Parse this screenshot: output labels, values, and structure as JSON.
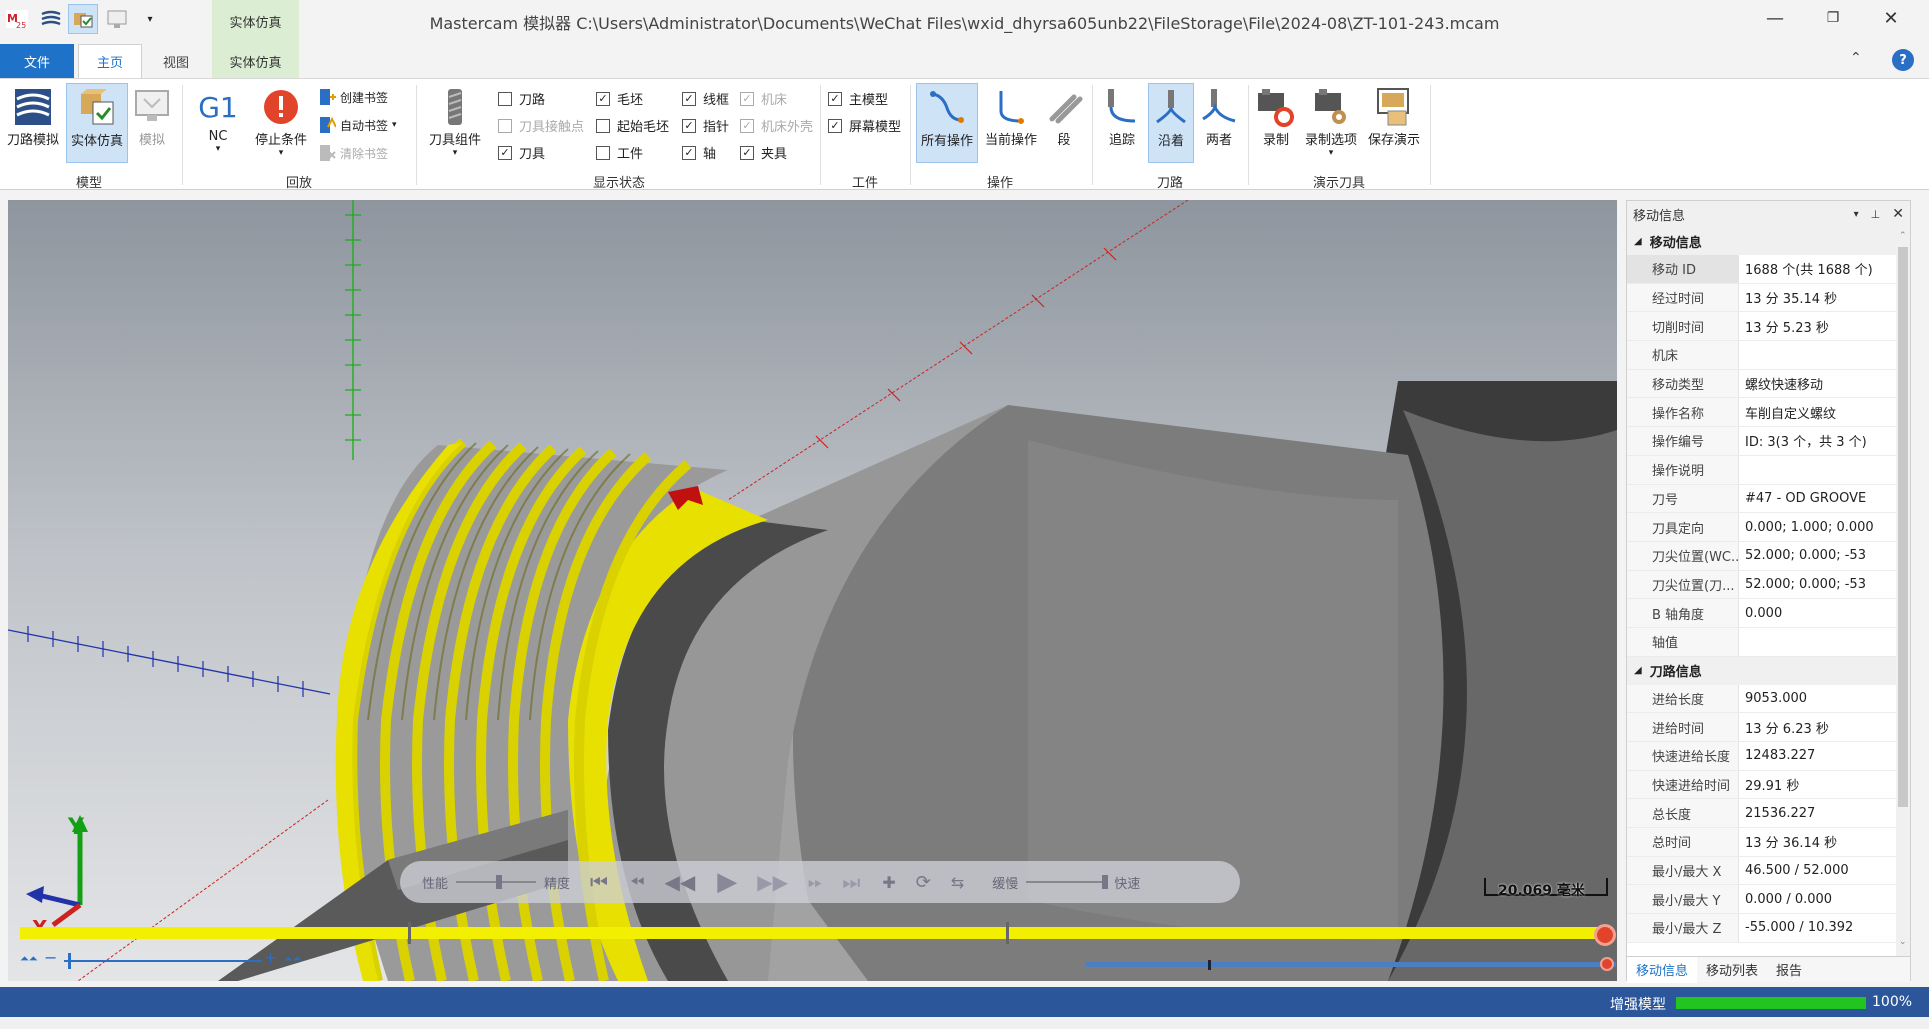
{
  "app": {
    "title": "Mastercam 模拟器  C:\\Users\\Administrator\\Documents\\WeChat Files\\wxid_dhyrsa605unb22\\FileStorage\\File\\2024-08\\ZT-101-243.mcam",
    "logo_text": "25",
    "context_tab_group": "实体仿真",
    "context_tab": "实体仿真"
  },
  "window_controls": {
    "minimize": "—",
    "restore": "❐",
    "close": "✕"
  },
  "tabs": [
    {
      "label": "文件"
    },
    {
      "label": "主页"
    },
    {
      "label": "视图"
    },
    {
      "label": "实体仿真"
    }
  ],
  "ribbon": {
    "groups": {
      "model": "模型",
      "playback": "回放",
      "visibility": "显示状态",
      "workpiece": "工件",
      "operation": "操作",
      "toolpath": "刀路",
      "demo_tool": "演示刀具"
    },
    "model_buttons": [
      "刀路模拟",
      "实体仿真",
      "模拟"
    ],
    "nc_label": "G1",
    "nc_sub": "NC",
    "stop_condition": "停止条件",
    "bookmarks": [
      "创建书签",
      "自动书签",
      "清除书签"
    ],
    "tool_component": "刀具组件",
    "checkboxes": [
      {
        "label": "刀路",
        "checked": false,
        "enabled": true
      },
      {
        "label": "刀具接触点",
        "checked": false,
        "enabled": false
      },
      {
        "label": "刀具",
        "checked": true,
        "enabled": true
      },
      {
        "label": "毛坯",
        "checked": true,
        "enabled": true
      },
      {
        "label": "起始毛坯",
        "checked": false,
        "enabled": true
      },
      {
        "label": "工件",
        "checked": false,
        "enabled": true
      },
      {
        "label": "线框",
        "checked": true,
        "enabled": true
      },
      {
        "label": "指针",
        "checked": true,
        "enabled": true
      },
      {
        "label": "轴",
        "checked": true,
        "enabled": true
      },
      {
        "label": "机床",
        "checked": true,
        "enabled": false
      },
      {
        "label": "机床外壳",
        "checked": true,
        "enabled": false
      },
      {
        "label": "夹具",
        "checked": true,
        "enabled": true
      },
      {
        "label": "主模型",
        "checked": true,
        "enabled": true
      },
      {
        "label": "屏幕模型",
        "checked": true,
        "enabled": true
      }
    ],
    "operation_buttons": [
      "所有操作",
      "当前操作",
      "段"
    ],
    "toolpath_buttons": [
      "追踪",
      "沿着",
      "两者"
    ],
    "demo_buttons": [
      "录制",
      "录制选项",
      "保存演示"
    ]
  },
  "viewport": {
    "scale_label": "20.069 毫米",
    "axis_y": "Y",
    "axis_x": "X",
    "playbar": {
      "left_label": "性能",
      "mid_label": "精度",
      "slow_label": "缓慢",
      "fast_label": "快速"
    }
  },
  "panel": {
    "title": "移动信息",
    "sections": [
      {
        "title": "移动信息",
        "rows": [
          {
            "k": "移动 ID",
            "v": "1688 个(共 1688 个)"
          },
          {
            "k": "经过时间",
            "v": "13 分 35.14 秒"
          },
          {
            "k": "切削时间",
            "v": "13 分 5.23 秒"
          },
          {
            "k": "机床",
            "v": ""
          },
          {
            "k": "移动类型",
            "v": "螺纹快速移动"
          },
          {
            "k": "操作名称",
            "v": "车削自定义螺纹"
          },
          {
            "k": "操作编号",
            "v": "ID: 3(3 个，共 3 个)"
          },
          {
            "k": "操作说明",
            "v": ""
          },
          {
            "k": "刀号",
            "v": "#47 - OD GROOVE"
          },
          {
            "k": "刀具定向",
            "v": "0.000; 1.000; 0.000"
          },
          {
            "k": "刀尖位置(WC...",
            "v": "52.000; 0.000; -53"
          },
          {
            "k": "刀尖位置(刀...",
            "v": "52.000; 0.000; -53"
          },
          {
            "k": "B 轴角度",
            "v": "0.000"
          },
          {
            "k": "轴值",
            "v": ""
          }
        ]
      },
      {
        "title": "刀路信息",
        "rows": [
          {
            "k": "进给长度",
            "v": "9053.000"
          },
          {
            "k": "进给时间",
            "v": "13 分 6.23 秒"
          },
          {
            "k": "快速进给长度",
            "v": "12483.227"
          },
          {
            "k": "快速进给时间",
            "v": "29.91 秒"
          },
          {
            "k": "总长度",
            "v": "21536.227"
          },
          {
            "k": "总时间",
            "v": "13 分 36.14 秒"
          },
          {
            "k": "最小/最大 X",
            "v": "46.500 / 52.000"
          },
          {
            "k": "最小/最大 Y",
            "v": "0.000 / 0.000"
          },
          {
            "k": "最小/最大 Z",
            "v": "-55.000 / 10.392"
          }
        ]
      }
    ],
    "tabs": [
      "移动信息",
      "移动列表",
      "报告"
    ]
  },
  "status": {
    "label": "增强模型",
    "progress_value": 1.0,
    "percent": "100%"
  },
  "colors": {
    "accent": "#1e73c9",
    "statusbar": "#2b569a",
    "progress": "#22c41f",
    "thread": "#e7e000"
  }
}
